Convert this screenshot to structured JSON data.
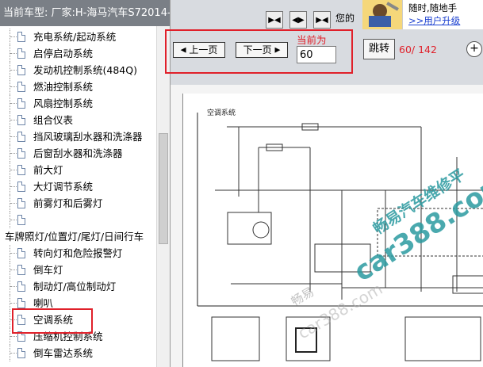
{
  "left_panel": {
    "header": "当前车型:  厂家:H-海马汽车S72014-",
    "tree": [
      {
        "label": "充电系统/起动系统",
        "type": "doc"
      },
      {
        "label": "启停启动系统",
        "type": "doc"
      },
      {
        "label": "发动机控制系统(484Q)",
        "type": "doc"
      },
      {
        "label": "燃油控制系统",
        "type": "doc"
      },
      {
        "label": "风扇控制系统",
        "type": "doc"
      },
      {
        "label": "组合仪表",
        "type": "doc"
      },
      {
        "label": "挡风玻璃刮水器和洗涤器",
        "type": "doc"
      },
      {
        "label": "后窗刮水器和洗涤器",
        "type": "doc"
      },
      {
        "label": "前大灯",
        "type": "doc"
      },
      {
        "label": "大灯调节系统",
        "type": "doc"
      },
      {
        "label": "前雾灯和后雾灯",
        "type": "doc"
      },
      {
        "label": "",
        "type": "doc"
      },
      {
        "label": "车牌照灯/位置灯/尾灯/日间行车",
        "type": "folder"
      },
      {
        "label": "转向灯和危险报警灯",
        "type": "doc"
      },
      {
        "label": "倒车灯",
        "type": "doc"
      },
      {
        "label": "制动灯/高位制动灯",
        "type": "doc"
      },
      {
        "label": "喇叭",
        "type": "doc"
      },
      {
        "label": "空调系统",
        "type": "doc",
        "selected": true
      },
      {
        "label": "压缩机控制系统",
        "type": "doc"
      },
      {
        "label": "倒车雷达系统",
        "type": "doc"
      }
    ]
  },
  "top_bar": {
    "hint": "您的",
    "ad_line1": "随时,随地手",
    "ad_line2": ">>用户升级"
  },
  "controls": {
    "prev_label": "上一页",
    "next_label": "下一页",
    "current_label": "当前为",
    "current_page": "60",
    "jump_label": "跳转",
    "page_count": "60/ 142",
    "zoom_symbol": "+"
  },
  "diagram": {
    "title": "空调系统",
    "watermark_brand": "畅易汽车维修平",
    "watermark_site": "car388.com",
    "watermark_side": "畅易",
    "watermark_faint": "car388.com"
  },
  "colors": {
    "header_bg": "#7a7f86",
    "toolbar_bg": "#d8dbe0",
    "accent_red": "#e0202a",
    "watermark_teal": "#2a9aa0",
    "link_blue": "#1a3fd0"
  }
}
